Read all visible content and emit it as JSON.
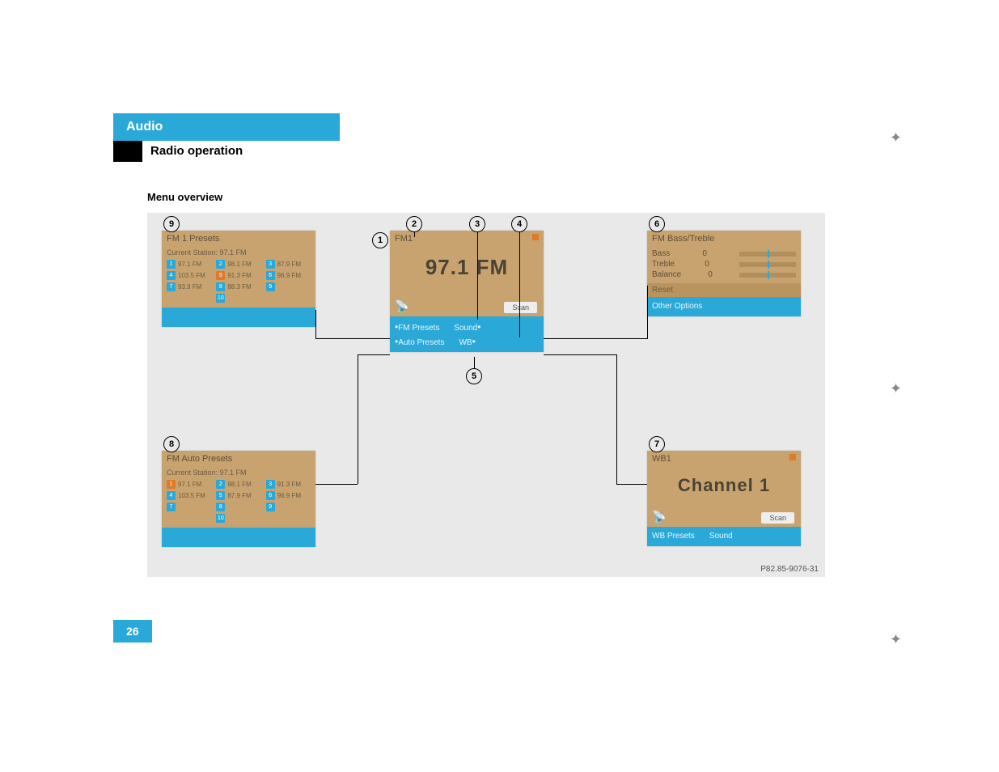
{
  "chapter": "Audio",
  "section": "Radio operation",
  "subtitle": "Menu overview",
  "page_number": "26",
  "image_code": "P82.85-9076-31",
  "callouts": [
    "1",
    "2",
    "3",
    "4",
    "5",
    "6",
    "7",
    "8",
    "9"
  ],
  "screens": {
    "fm1_presets": {
      "title": "FM 1 Presets",
      "subtitle": "Current Station: 97.1 FM",
      "presets": [
        {
          "n": "1",
          "f": "97.1 FM"
        },
        {
          "n": "2",
          "f": "98.1 FM"
        },
        {
          "n": "3",
          "f": "87.9 FM"
        },
        {
          "n": "4",
          "f": "103.5 FM"
        },
        {
          "n": "5",
          "f": "91.3 FM"
        },
        {
          "n": "6",
          "f": "96.9 FM"
        },
        {
          "n": "7",
          "f": "93.9 FM"
        },
        {
          "n": "8",
          "f": "88.3 FM"
        },
        {
          "n": "9",
          "f": ""
        },
        {
          "n": "",
          "f": ""
        },
        {
          "n": "10",
          "f": ""
        },
        {
          "n": "",
          "f": ""
        }
      ]
    },
    "main": {
      "band": "FM1",
      "frequency": "97.1 FM",
      "scan": "Scan",
      "soft": {
        "fm_presets": "FM Presets",
        "sound": "Sound",
        "auto_presets": "Auto Presets",
        "wb": "WB"
      }
    },
    "bass_treble": {
      "title": "FM Bass/Treble",
      "rows": [
        {
          "label": "Bass",
          "val": "0"
        },
        {
          "label": "Treble",
          "val": "0"
        },
        {
          "label": "Balance",
          "val": "0"
        }
      ],
      "reset": "Reset",
      "other": "Other Options"
    },
    "auto_presets": {
      "title": "FM Auto Presets",
      "subtitle": "Current Station: 97.1 FM",
      "presets": [
        {
          "n": "1",
          "f": "97.1 FM"
        },
        {
          "n": "2",
          "f": "98.1 FM"
        },
        {
          "n": "3",
          "f": "91.3 FM"
        },
        {
          "n": "4",
          "f": "103.5 FM"
        },
        {
          "n": "5",
          "f": "87.9 FM"
        },
        {
          "n": "6",
          "f": "96.9 FM"
        },
        {
          "n": "7",
          "f": ""
        },
        {
          "n": "8",
          "f": ""
        },
        {
          "n": "9",
          "f": ""
        },
        {
          "n": "",
          "f": ""
        },
        {
          "n": "10",
          "f": ""
        },
        {
          "n": "",
          "f": ""
        }
      ]
    },
    "wb": {
      "title": "WB1",
      "channel": "Channel 1",
      "scan": "Scan",
      "soft": {
        "presets": "WB Presets",
        "sound": "Sound"
      }
    }
  }
}
